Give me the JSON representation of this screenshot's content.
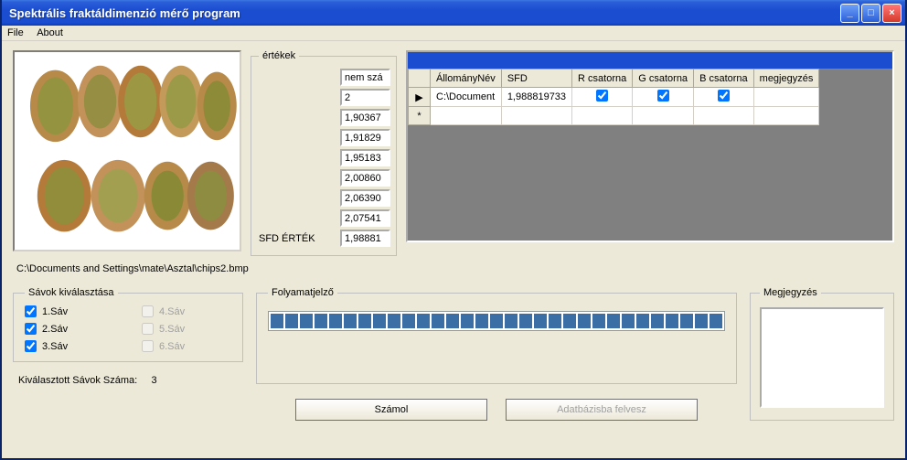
{
  "window": {
    "title": "Spektrális fraktáldimenzió mérő program"
  },
  "menu": {
    "file": "File",
    "about": "About"
  },
  "values": {
    "legend": "értékek",
    "sfd_label": "SFD ÉRTÉK",
    "rows": [
      "nem szá",
      "2",
      "1,90367",
      "1,91829",
      "1,95183",
      "2,00860",
      "2,06390",
      "2,07541",
      "1,98881"
    ]
  },
  "grid": {
    "headers": [
      "ÁllományNév",
      "SFD",
      "R csatorna",
      "G csatorna",
      "B csatorna",
      "megjegyzés"
    ],
    "row": {
      "filenev": "C:\\Document",
      "sfd": "1,988819733",
      "r": true,
      "g": true,
      "b": true,
      "megj": ""
    }
  },
  "path": "C:\\Documents and Settings\\mate\\Asztal\\chips2.bmp",
  "bands": {
    "legend": "Sávok kiválasztása",
    "items": [
      {
        "label": "1.Sáv",
        "checked": true,
        "enabled": true
      },
      {
        "label": "2.Sáv",
        "checked": true,
        "enabled": true
      },
      {
        "label": "3.Sáv",
        "checked": true,
        "enabled": true
      },
      {
        "label": "4.Sáv",
        "checked": false,
        "enabled": false
      },
      {
        "label": "5.Sáv",
        "checked": false,
        "enabled": false
      },
      {
        "label": "6.Sáv",
        "checked": false,
        "enabled": false
      }
    ],
    "selected_label": "Kiválasztott Sávok Száma:",
    "selected_count": "3"
  },
  "progress": {
    "legend": "Folyamatjelző",
    "segments": 31
  },
  "buttons": {
    "calc": "Számol",
    "todb": "Adatbázisba felvesz"
  },
  "note": {
    "legend": "Megjegyzés",
    "value": ""
  }
}
